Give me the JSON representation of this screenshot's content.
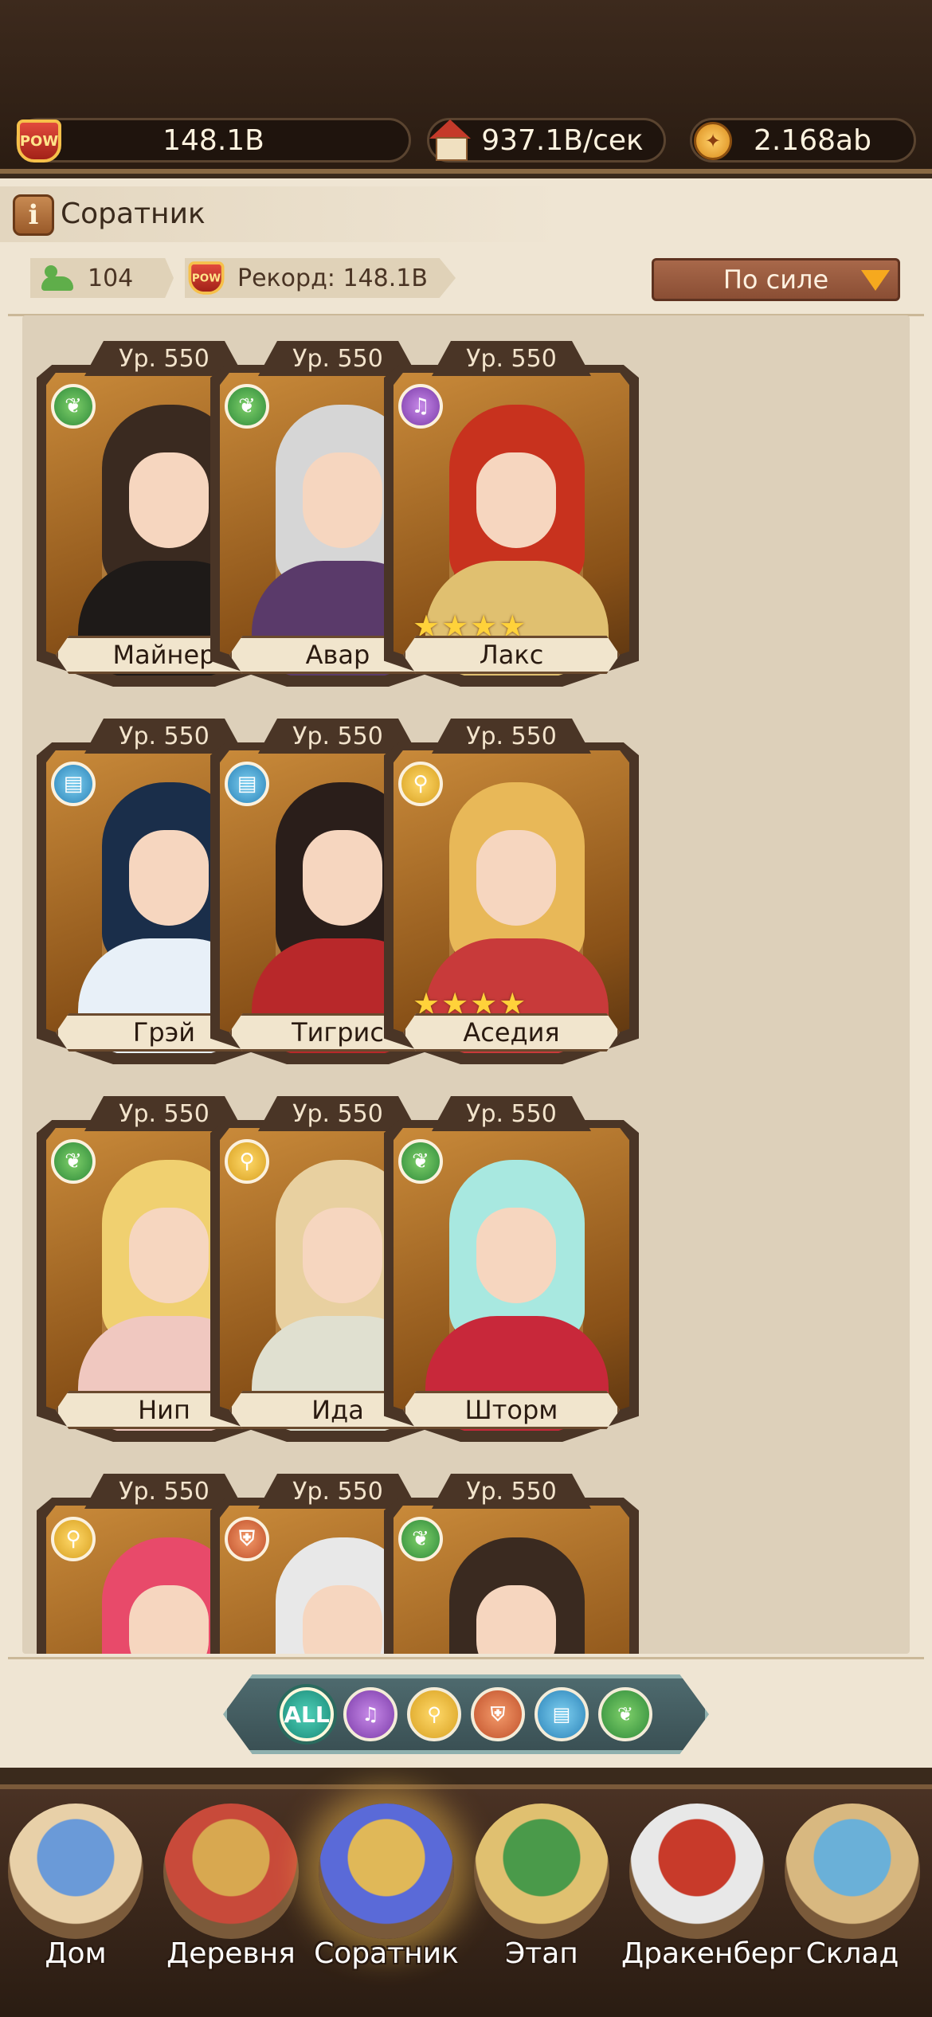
{
  "top_bar": {
    "power": "148.1B",
    "power_icon_text": "POW",
    "income": "937.1B/сек",
    "gems": "2.168ab"
  },
  "header": {
    "title": "Соратник",
    "info_icon": "i"
  },
  "stats": {
    "count": "104",
    "record": "Рекорд: 148.1B",
    "sort_label": "По силе"
  },
  "heroes": [
    {
      "level": "Ур. 550",
      "name": "Майнер",
      "class": "wing-icon",
      "stars": ""
    },
    {
      "level": "Ур. 550",
      "name": "Авар",
      "class": "wing-icon",
      "stars": ""
    },
    {
      "level": "Ур. 550",
      "name": "Лакс",
      "class": "lyre-icon",
      "stars": "★★★★"
    },
    {
      "level": "Ур. 550",
      "name": "Грэй",
      "class": "book-icon",
      "stars": ""
    },
    {
      "level": "Ур. 550",
      "name": "Тигрис",
      "class": "book-icon",
      "stars": ""
    },
    {
      "level": "Ур. 550",
      "name": "Аседия",
      "class": "broom-icon",
      "stars": "★★★★"
    },
    {
      "level": "Ур. 550",
      "name": "Нип",
      "class": "wing-icon",
      "stars": ""
    },
    {
      "level": "Ур. 550",
      "name": "Ида",
      "class": "broom-icon",
      "stars": ""
    },
    {
      "level": "Ур. 550",
      "name": "Шторм",
      "class": "wing-icon",
      "stars": ""
    },
    {
      "level": "Ур. 550",
      "name": "",
      "class": "broom-icon",
      "stars": ""
    },
    {
      "level": "Ур. 550",
      "name": "",
      "class": "shield-icon",
      "stars": ""
    },
    {
      "level": "Ур. 550",
      "name": "",
      "class": "wing-icon",
      "stars": ""
    }
  ],
  "filters": [
    {
      "label": "ALL",
      "icon": "all-icon"
    },
    {
      "label": "",
      "icon": "lyre-icon"
    },
    {
      "label": "",
      "icon": "broom-icon"
    },
    {
      "label": "",
      "icon": "shield-icon"
    },
    {
      "label": "",
      "icon": "book-icon"
    },
    {
      "label": "",
      "icon": "wing-icon"
    }
  ],
  "nav": [
    {
      "label": "Дом",
      "icon": "bed-icon"
    },
    {
      "label": "Деревня",
      "icon": "windmill-icon"
    },
    {
      "label": "Соратник",
      "icon": "companions-icon"
    },
    {
      "label": "Этап",
      "icon": "camp-icon"
    },
    {
      "label": "Дракенберг",
      "icon": "castle-icon"
    },
    {
      "label": "Склад",
      "icon": "storage-icon"
    }
  ],
  "colors": {
    "accent": "#f6a91e",
    "panel": "#efe5d3",
    "frame": "#4a3526"
  }
}
